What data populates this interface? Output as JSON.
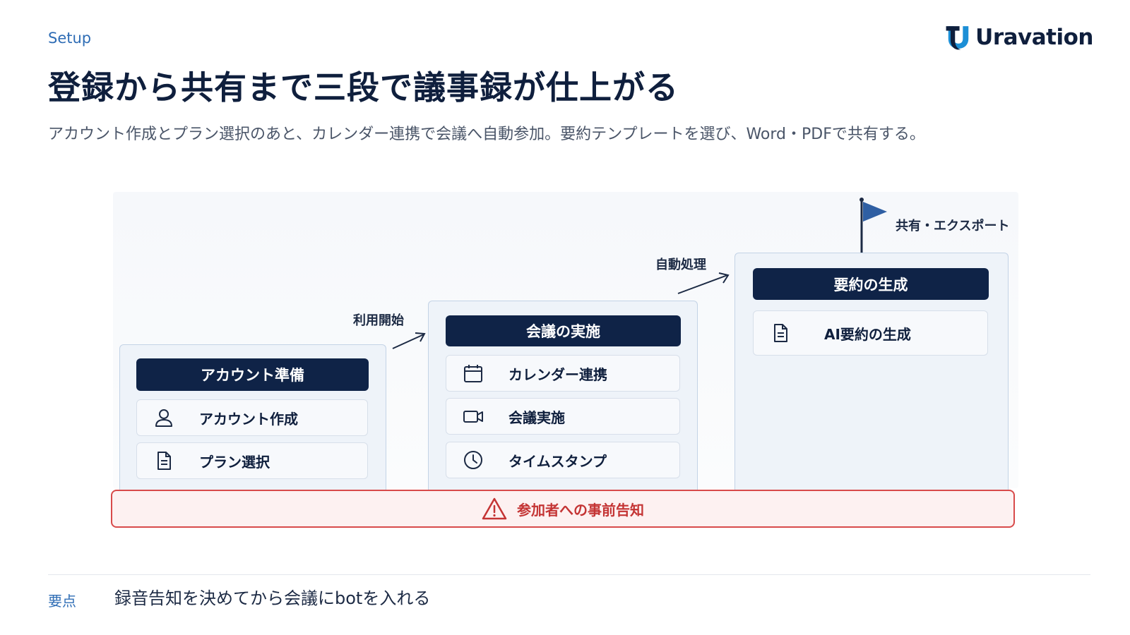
{
  "header": {
    "section_label": "Setup",
    "logo_text": "Uravation",
    "title": "登録から共有まで三段で議事録が仕上がる",
    "subtitle": "アカウント作成とプラン選択のあと、カレンダー連携で会議へ自動参加。要約テンプレートを選び、Word・PDFで共有する。"
  },
  "diagram": {
    "stages": [
      {
        "title": "アカウント準備",
        "items": [
          {
            "label": "アカウント作成",
            "icon": "user-icon"
          },
          {
            "label": "プラン選択",
            "icon": "document-icon"
          }
        ]
      },
      {
        "title": "会議の実施",
        "items": [
          {
            "label": "カレンダー連携",
            "icon": "calendar-icon"
          },
          {
            "label": "会議実施",
            "icon": "video-camera-icon"
          },
          {
            "label": "タイムスタンプ",
            "icon": "clock-icon"
          }
        ]
      },
      {
        "title": "要約の生成",
        "items": [
          {
            "label": "AI要約の生成",
            "icon": "document-icon"
          }
        ]
      }
    ],
    "transitions": [
      "利用開始",
      "自動処理"
    ],
    "goal_label": "共有・エクスポート",
    "goal_icon": "flag-icon",
    "warning": {
      "text": "参加者への事前告知",
      "icon": "warning-triangle-icon"
    }
  },
  "footer": {
    "key_label": "要点",
    "key_text": "録音告知を決めてから会議にbotを入れる"
  },
  "colors": {
    "navy": "#0f2347",
    "accent_blue": "#2f6db5",
    "warning_red": "#d84a4a",
    "stage_bg": "#eef3f9"
  }
}
